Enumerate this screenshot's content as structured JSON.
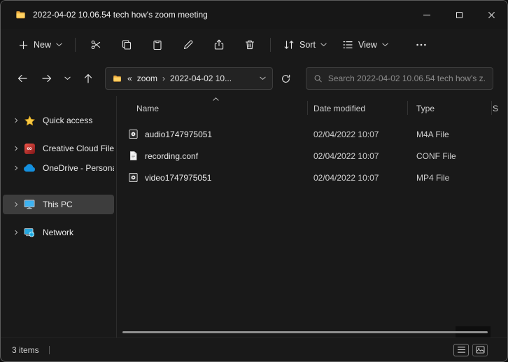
{
  "titlebar": {
    "title": "2022-04-02 10.06.54 tech how's zoom meeting"
  },
  "toolbar": {
    "new_label": "New",
    "sort_label": "Sort",
    "view_label": "View"
  },
  "navigation": {
    "breadcrumb_collapsed": "«",
    "breadcrumb_root": "zoom",
    "breadcrumb_separator": "›",
    "breadcrumb_current": "2022-04-02 10...",
    "search_placeholder": "Search 2022-04-02 10.06.54 tech how's z..."
  },
  "sidebar": {
    "items": [
      {
        "label": "Quick access",
        "icon": "star-icon",
        "selected": false
      },
      {
        "label": "Creative Cloud Files",
        "icon": "creative-cloud-icon",
        "selected": false
      },
      {
        "label": "OneDrive - Personal",
        "icon": "onedrive-cloud-icon",
        "selected": false
      },
      {
        "label": "This PC",
        "icon": "monitor-icon",
        "selected": true
      },
      {
        "label": "Network",
        "icon": "network-icon",
        "selected": false
      }
    ]
  },
  "file_list": {
    "columns": {
      "name": "Name",
      "date_modified": "Date modified",
      "type": "Type",
      "size": "S"
    },
    "sort": {
      "column": "Name",
      "direction": "ascending"
    },
    "rows": [
      {
        "name": "audio1747975051",
        "date_modified": "02/04/2022 10:07",
        "type": "M4A File",
        "icon": "audio-file-icon"
      },
      {
        "name": "recording.conf",
        "date_modified": "02/04/2022 10:07",
        "type": "CONF File",
        "icon": "config-file-icon"
      },
      {
        "name": "video1747975051",
        "date_modified": "02/04/2022 10:07",
        "type": "MP4 File",
        "icon": "video-file-icon"
      }
    ]
  },
  "status_bar": {
    "items_count": "3 items"
  },
  "colors": {
    "accent": "#4cc2ff",
    "window_bg": "#191919",
    "titlebar_bg": "#171717",
    "field_bg": "#232323",
    "selected_bg": "#3d3d3d",
    "folder_yellow": "#ffd262"
  }
}
